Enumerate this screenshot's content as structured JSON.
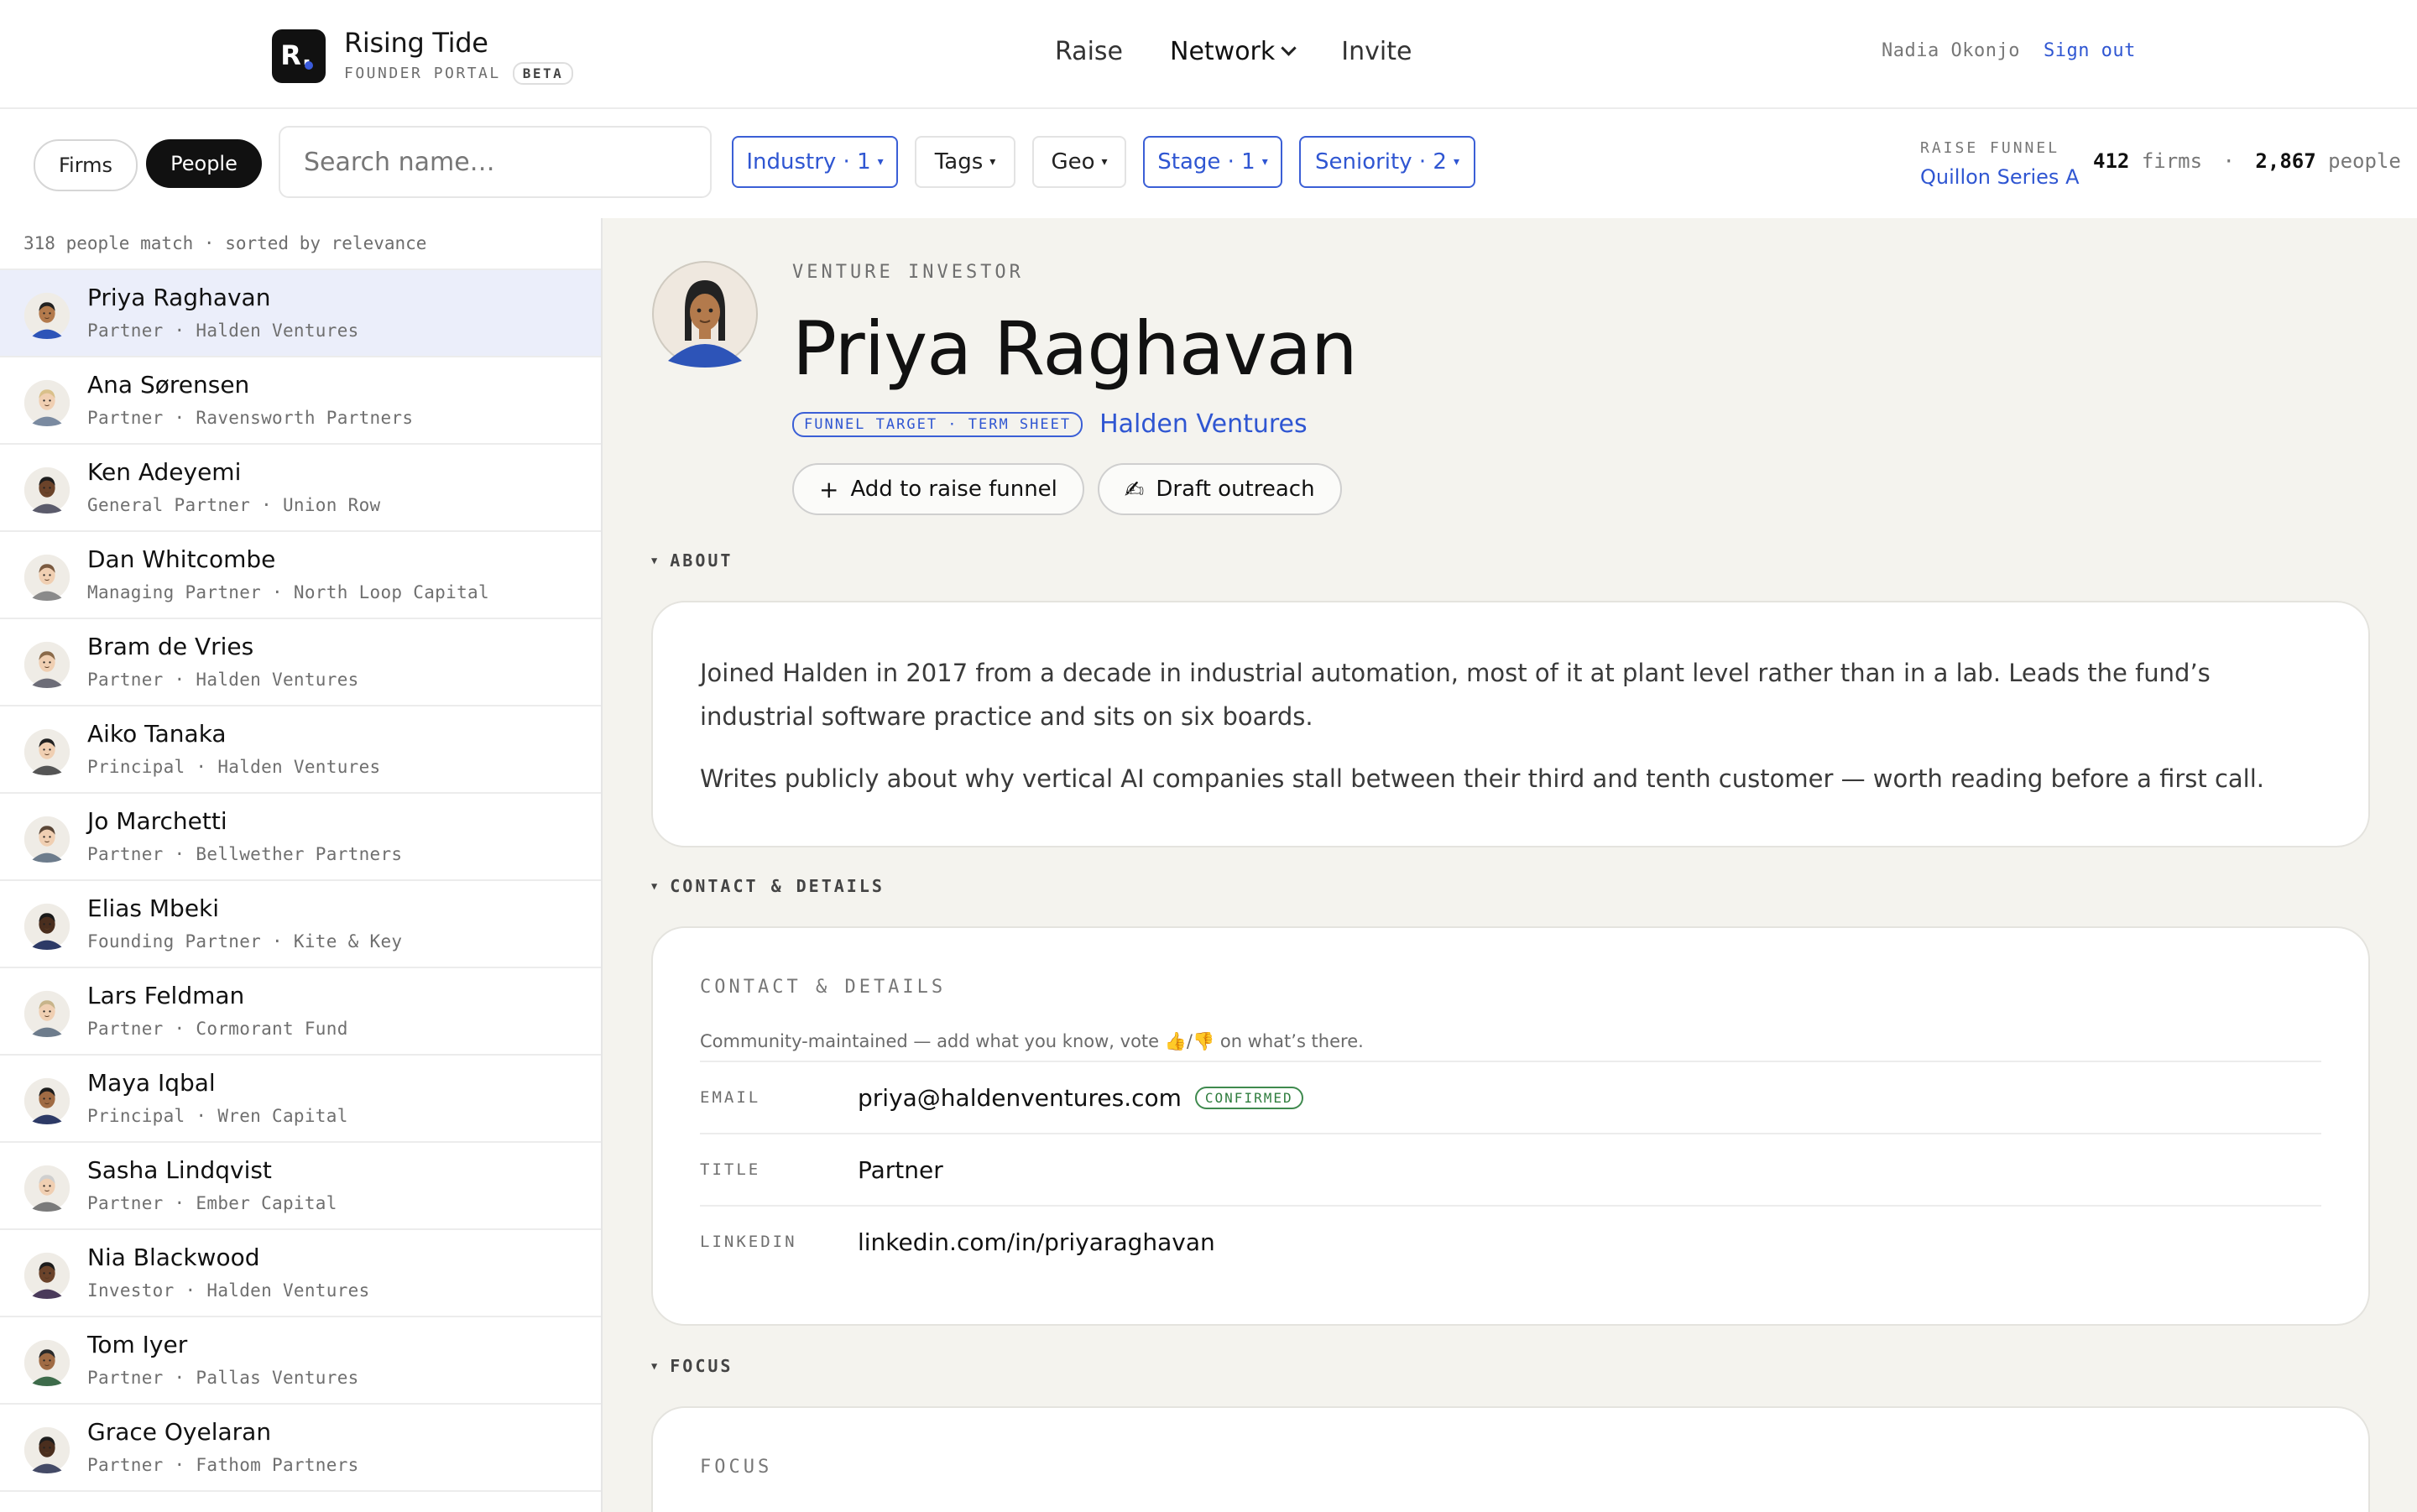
{
  "brand": {
    "name": "Rising Tide",
    "logo_letter": "R.",
    "subtitle": "FOUNDER PORTAL",
    "badge": "BETA",
    "accent": "#2f56d2"
  },
  "nav": {
    "items": [
      {
        "label": "Raise"
      },
      {
        "label": "Network"
      },
      {
        "label": "Invite"
      }
    ]
  },
  "user": {
    "name": "Nadia Okonjo",
    "signout": "Sign out"
  },
  "filters": {
    "toggle": {
      "firms": "Firms",
      "people": "People",
      "selected": "People"
    },
    "search_placeholder": "Search name…",
    "chips": [
      {
        "label": "Industry · 1",
        "active": true
      },
      {
        "label": "Tags",
        "active": false
      },
      {
        "label": "Geo",
        "active": false
      },
      {
        "label": "Stage · 1",
        "active": true
      },
      {
        "label": "Seniority · 2",
        "active": true
      }
    ]
  },
  "funnel": {
    "label": "RAISE FUNNEL",
    "name": "Quillon Series A",
    "firms_count": "412",
    "firms_word": "firms",
    "sep": "·",
    "people_count": "2,867",
    "people_word": "people"
  },
  "list": {
    "summary": "318 people match · sorted by relevance",
    "people": [
      {
        "name": "Priya Raghavan",
        "sub": "Partner · Halden Ventures",
        "selected": true
      },
      {
        "name": "Ana Sørensen",
        "sub": "Partner · Ravensworth Partners"
      },
      {
        "name": "Ken Adeyemi",
        "sub": "General Partner · Union Row"
      },
      {
        "name": "Dan Whitcombe",
        "sub": "Managing Partner · North Loop Capital"
      },
      {
        "name": "Bram de Vries",
        "sub": "Partner · Halden Ventures"
      },
      {
        "name": "Aiko Tanaka",
        "sub": "Principal · Halden Ventures"
      },
      {
        "name": "Jo Marchetti",
        "sub": "Partner · Bellwether Partners"
      },
      {
        "name": "Elias Mbeki",
        "sub": "Founding Partner · Kite & Key"
      },
      {
        "name": "Lars Feldman",
        "sub": "Partner · Cormorant Fund"
      },
      {
        "name": "Maya Iqbal",
        "sub": "Principal · Wren Capital"
      },
      {
        "name": "Sasha Lindqvist",
        "sub": "Partner · Ember Capital"
      },
      {
        "name": "Nia Blackwood",
        "sub": "Investor · Halden Ventures"
      },
      {
        "name": "Tom Iyer",
        "sub": "Partner · Pallas Ventures"
      },
      {
        "name": "Grace Oyelaran",
        "sub": "Partner · Fathom Partners"
      }
    ]
  },
  "detail": {
    "kicker": "VENTURE INVESTOR",
    "name": "Priya Raghavan",
    "funnel_tag": "FUNNEL TARGET · TERM SHEET",
    "firm": "Halden Ventures",
    "actions": {
      "add": "Add to raise funnel",
      "draft": "Draft outreach"
    },
    "about": {
      "heading": "ABOUT",
      "p1": "Joined Halden in 2017 from a decade in industrial automation, most of it at plant level rather than in a lab. Leads the fund’s industrial software practice and sits on six boards.",
      "p2": "Writes publicly about why vertical AI companies stall between their third and tenth customer — worth reading before a first call."
    },
    "contact": {
      "heading": "CONTACT & DETAILS",
      "card_label": "CONTACT & DETAILS",
      "community_pre": "Community-maintained — add what you know, vote",
      "community_post": "on what’s there.",
      "email_key": "EMAIL",
      "email": "priya@haldenventures.com",
      "email_status": "CONFIRMED",
      "title_key": "TITLE",
      "title": "Partner",
      "linkedin_key": "LINKEDIN",
      "linkedin": "linkedin.com/in/priyaraghavan"
    },
    "focus": {
      "heading": "FOCUS",
      "card_label": "FOCUS"
    }
  }
}
